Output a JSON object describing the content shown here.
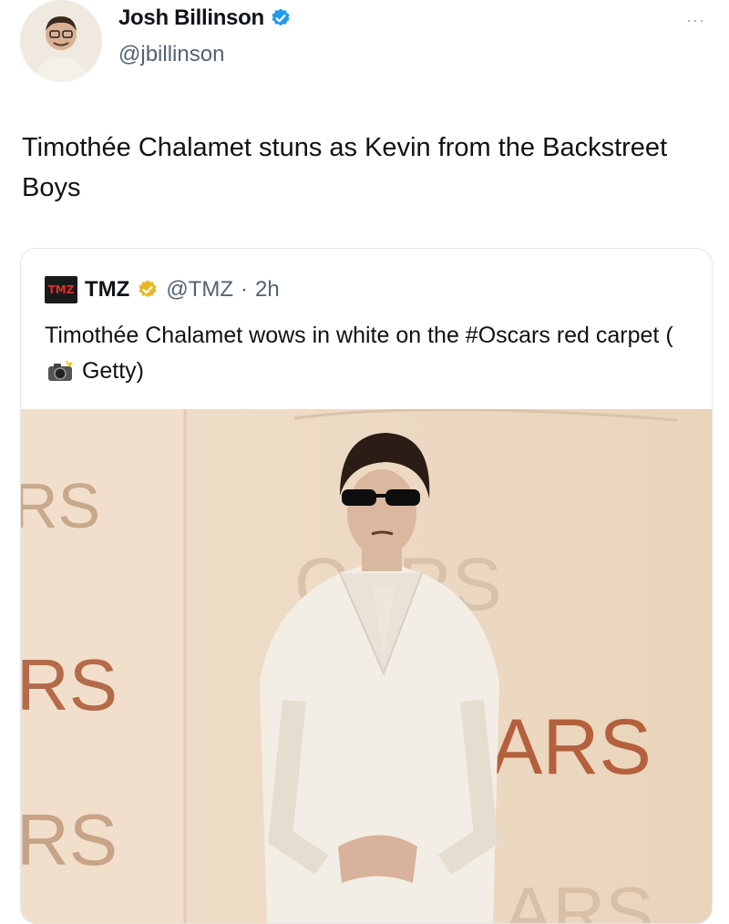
{
  "author": {
    "name": "Josh Billinson",
    "handle": "@jbillinson",
    "more_label": "···",
    "verified_color": "#1d9bf0"
  },
  "tweet": {
    "text": "Timothée Chalamet stuns as Kevin from the Backstreet Boys"
  },
  "quoted": {
    "logo_text": "TMZ",
    "name": "TMZ",
    "handle": "@TMZ",
    "separator": "·",
    "time": "2h",
    "text_before": "Timothée Chalamet wows in white on the #Oscars red carpet (",
    "text_after": " Getty)",
    "badge_color": "#e8b829"
  },
  "photo": {
    "backdrop_words": [
      "RS",
      "CARS",
      "RS",
      "ARS",
      "RS",
      "ARS"
    ]
  }
}
